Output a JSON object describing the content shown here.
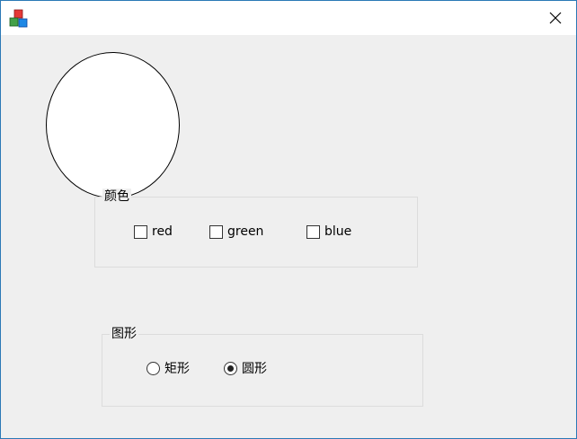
{
  "window": {
    "title": "",
    "close_glyph": "✕"
  },
  "color_group": {
    "label": "颜色",
    "options": [
      {
        "label": "red",
        "checked": false
      },
      {
        "label": "green",
        "checked": false
      },
      {
        "label": "blue",
        "checked": false
      }
    ]
  },
  "shape_group": {
    "label": "图形",
    "options": [
      {
        "label": "矩形",
        "selected": false
      },
      {
        "label": "圆形",
        "selected": true
      }
    ]
  },
  "drawing": {
    "shape": "ellipse",
    "fill": "#ffffff",
    "stroke": "#000000"
  }
}
